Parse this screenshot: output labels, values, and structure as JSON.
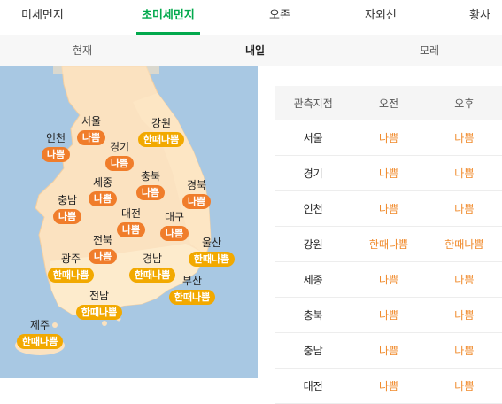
{
  "top_tabs": [
    "미세먼지",
    "초미세먼지",
    "오존",
    "자외선",
    "황사"
  ],
  "sub_tabs": [
    "현재",
    "내일",
    "모레"
  ],
  "active_top_tab": "초미세먼지",
  "active_sub_tab": "내일",
  "colors": {
    "accent": "#03a94d",
    "bad": "#f07d2b",
    "very_bad": "#f2a900",
    "sea": "#a8c8e3",
    "land": "#fbe2c0"
  },
  "map_regions": [
    {
      "name": "서울",
      "status": "나쁨"
    },
    {
      "name": "강원",
      "status": "한때나쁨"
    },
    {
      "name": "인천",
      "status": "나쁨"
    },
    {
      "name": "경기",
      "status": "나쁨"
    },
    {
      "name": "세종",
      "status": "나쁨"
    },
    {
      "name": "충북",
      "status": "나쁨"
    },
    {
      "name": "경북",
      "status": "나쁨"
    },
    {
      "name": "충남",
      "status": "나쁨"
    },
    {
      "name": "대전",
      "status": "나쁨"
    },
    {
      "name": "대구",
      "status": "나쁨"
    },
    {
      "name": "전북",
      "status": "나쁨"
    },
    {
      "name": "울산",
      "status": "한때나쁨"
    },
    {
      "name": "광주",
      "status": "한때나쁨"
    },
    {
      "name": "경남",
      "status": "한때나쁨"
    },
    {
      "name": "부산",
      "status": "한때나쁨"
    },
    {
      "name": "전남",
      "status": "한때나쁨"
    },
    {
      "name": "제주",
      "status": "한때나쁨"
    }
  ],
  "table": {
    "headers": [
      "관측지점",
      "오전",
      "오후"
    ],
    "rows": [
      [
        "서울",
        "나쁨",
        "나쁨"
      ],
      [
        "경기",
        "나쁨",
        "나쁨"
      ],
      [
        "인천",
        "나쁨",
        "나쁨"
      ],
      [
        "강원",
        "한때나쁨",
        "한때나쁨"
      ],
      [
        "세종",
        "나쁨",
        "나쁨"
      ],
      [
        "충북",
        "나쁨",
        "나쁨"
      ],
      [
        "충남",
        "나쁨",
        "나쁨"
      ],
      [
        "대전",
        "나쁨",
        "나쁨"
      ]
    ]
  }
}
